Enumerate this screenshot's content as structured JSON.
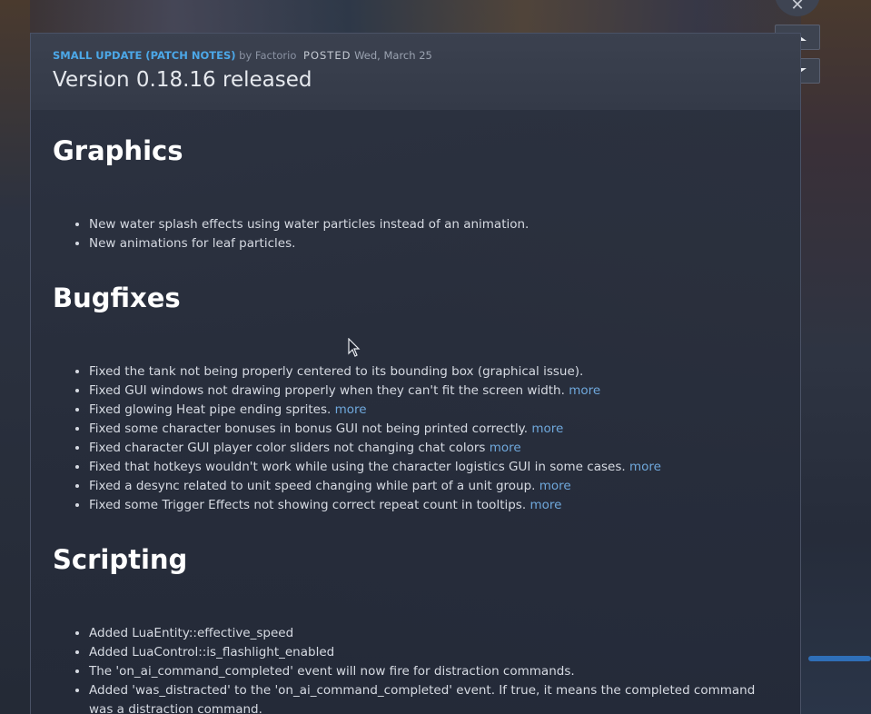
{
  "header": {
    "type": "SMALL UPDATE (PATCH NOTES)",
    "by": "by Factorio",
    "posted_label": "POSTED",
    "date": "Wed, March 25",
    "title": "Version 0.18.16 released"
  },
  "controls": {
    "close": "✕"
  },
  "sections": [
    {
      "heading": "Graphics",
      "items": [
        {
          "text": "New water splash effects using water particles instead of an animation.",
          "more": ""
        },
        {
          "text": "New animations for leaf particles.",
          "more": ""
        }
      ]
    },
    {
      "heading": "Bugfixes",
      "items": [
        {
          "text": "Fixed the tank not being properly centered to its bounding box (graphical issue).",
          "more": ""
        },
        {
          "text": "Fixed GUI windows not drawing properly when they can't fit the screen width.",
          "more": "more"
        },
        {
          "text": "Fixed glowing Heat pipe ending sprites.",
          "more": "more"
        },
        {
          "text": "Fixed some character bonuses in bonus GUI not being printed correctly.",
          "more": "more"
        },
        {
          "text": "Fixed character GUI player color sliders not changing chat colors",
          "more": "more"
        },
        {
          "text": "Fixed that hotkeys wouldn't work while using the character logistics GUI in some cases.",
          "more": "more"
        },
        {
          "text": "Fixed a desync related to unit speed changing while part of a unit group.",
          "more": "more"
        },
        {
          "text": "Fixed some Trigger Effects not showing correct repeat count in tooltips.",
          "more": "more"
        }
      ]
    },
    {
      "heading": "Scripting",
      "items": [
        {
          "text": "Added LuaEntity::effective_speed",
          "more": ""
        },
        {
          "text": "Added LuaControl::is_flashlight_enabled",
          "more": ""
        },
        {
          "text": "The 'on_ai_command_completed' event will now fire for distraction commands.",
          "more": ""
        },
        {
          "text": "Added 'was_distracted' to the 'on_ai_command_completed' event. If true, it means the completed command was a distraction command.",
          "more": ""
        }
      ]
    }
  ],
  "colors": {
    "accent": "#4ca8e8",
    "link": "#6fa8dc"
  }
}
